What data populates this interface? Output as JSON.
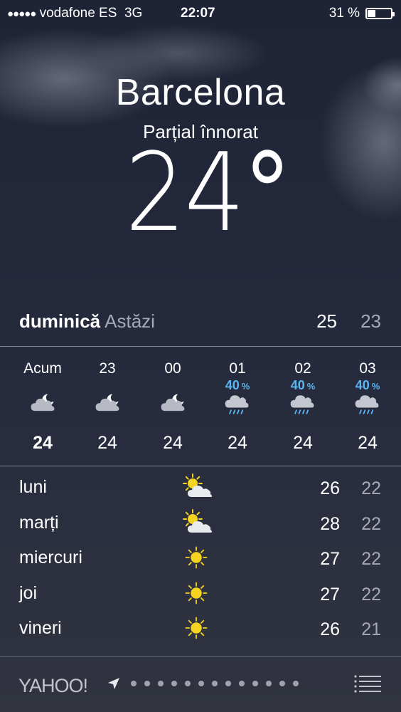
{
  "status_bar": {
    "signal_dots": "●●●●●",
    "carrier": "vodafone ES",
    "network": "3G",
    "time": "22:07",
    "battery_text": "31 %",
    "battery_level": 0.31
  },
  "location": {
    "city": "Barcelona",
    "condition": "Parțial înnorat",
    "temperature": "24",
    "degree": "°"
  },
  "today": {
    "day": "duminică",
    "label": "Astăzi",
    "high": "25",
    "low": "23"
  },
  "hourly": [
    {
      "time": "Acum",
      "precip": "",
      "precip_unit": "",
      "icon": "partly-cloudy-night-icon",
      "temp": "24"
    },
    {
      "time": "23",
      "precip": "",
      "precip_unit": "",
      "icon": "partly-cloudy-night-icon",
      "temp": "24"
    },
    {
      "time": "00",
      "precip": "",
      "precip_unit": "",
      "icon": "partly-cloudy-night-icon",
      "temp": "24"
    },
    {
      "time": "01",
      "precip": "40",
      "precip_unit": "%",
      "icon": "rain-icon",
      "temp": "24"
    },
    {
      "time": "02",
      "precip": "40",
      "precip_unit": "%",
      "icon": "rain-icon",
      "temp": "24"
    },
    {
      "time": "03",
      "precip": "40",
      "precip_unit": "%",
      "icon": "rain-icon",
      "temp": "24"
    }
  ],
  "daily": [
    {
      "day": "luni",
      "icon": "partly-sunny-icon",
      "high": "26",
      "low": "22"
    },
    {
      "day": "marți",
      "icon": "partly-sunny-icon",
      "high": "28",
      "low": "22"
    },
    {
      "day": "miercuri",
      "icon": "sun-icon",
      "high": "27",
      "low": "22"
    },
    {
      "day": "joi",
      "icon": "sun-icon",
      "high": "27",
      "low": "22"
    },
    {
      "day": "vineri",
      "icon": "sun-icon",
      "high": "26",
      "low": "21"
    }
  ],
  "footer": {
    "brand": "YAHOO!",
    "page_dots": 13,
    "current_location_icon": "location-arrow-icon",
    "list_icon": "list-icon"
  },
  "colors": {
    "precip": "#5ab5f0",
    "sun": "#f5d321",
    "secondary_text": "#a6a9b4"
  }
}
